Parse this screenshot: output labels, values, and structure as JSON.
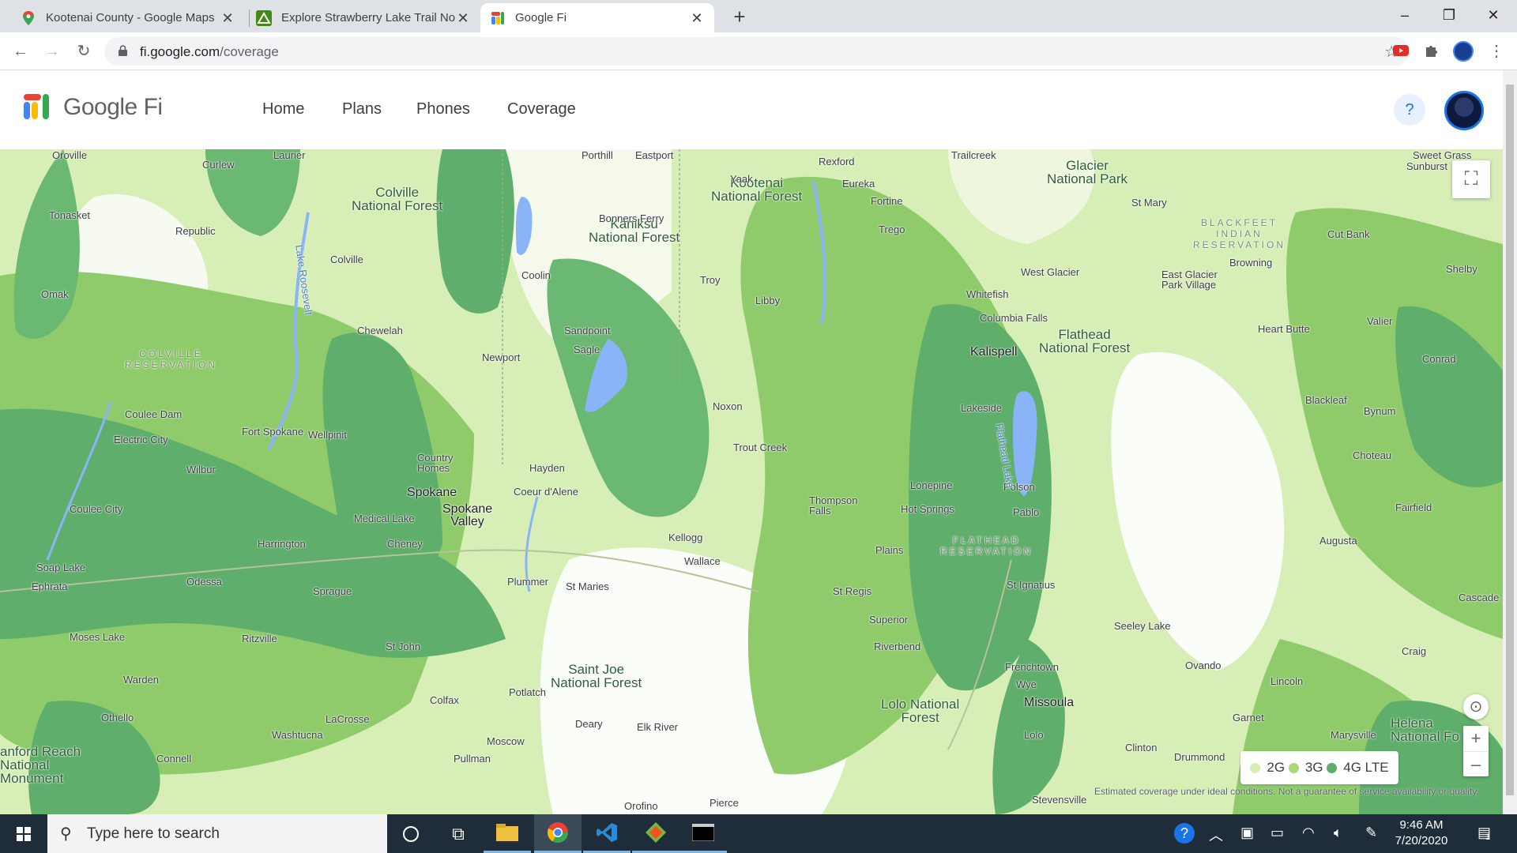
{
  "browser": {
    "tabs": [
      {
        "title": "Kootenai County - Google Maps",
        "icon": "google-maps-icon"
      },
      {
        "title": "Explore Strawberry Lake Trail No",
        "icon": "alltrails-icon"
      },
      {
        "title": "Google Fi",
        "icon": "google-fi-icon",
        "active": true
      }
    ],
    "url_host": "fi.google.com",
    "url_path": "/coverage"
  },
  "fi": {
    "brand": "Google Fi",
    "nav": [
      "Home",
      "Plans",
      "Phones",
      "Coverage"
    ],
    "help": "?"
  },
  "map": {
    "labels": {
      "colville_nf": "Colville\nNational Forest",
      "kootenai_nf": "Kootenai\nNational Forest",
      "kaniksu_nf": "Kaniksu\nNational Forest",
      "glacier_np": "Glacier\nNational Park",
      "flathead_nf": "Flathead\nNational Forest",
      "saint_joe_nf": "Saint Joe\nNational Forest",
      "lolo_nf": "Lolo National\nForest",
      "hanford": "anford Reach\nNational\nMonument",
      "helena_nf": "Helena\nNational Fo",
      "colville_res": "COLVILLE\nRESERVATION",
      "flathead_res": "FLATHEAD\nRESERVATION",
      "blackfeet_res": "BLACKFEET\nINDIAN\nRESERVATION",
      "spokane": "Spokane",
      "spokane_valley": "Spokane\nValley",
      "coeur": "Coeur d'Alene",
      "sandpoint": "Sandpoint",
      "kalispell": "Kalispell",
      "missoula": "Missoula",
      "polson": "Polson",
      "whitefish": "Whitefish",
      "libby": "Libby",
      "yaak": "Yaak",
      "coolin": "Coolin",
      "newport": "Newport",
      "colville": "Colville",
      "republic": "Republic",
      "chewelah": "Chewelah",
      "omak": "Omak",
      "tonasket": "Tonasket",
      "wilbur": "Wilbur",
      "odessa": "Odessa",
      "ritzville": "Ritzville",
      "sprague": "Sprague",
      "cheney": "Cheney",
      "harrington": "Harrington",
      "medical_lake": "Medical Lake",
      "st_maries": "St Maries",
      "plummer": "Plummer",
      "kellogg": "Kellogg",
      "wallace": "Wallace",
      "noxon": "Noxon",
      "trout_creek": "Trout Creek",
      "thompson_falls": "Thompson\nFalls",
      "hot_springs": "Hot Springs",
      "plains": "Plains",
      "st_regis": "St Regis",
      "superior": "Superior",
      "frenchtown": "Frenchtown",
      "lolo": "Lolo",
      "seeley_lake": "Seeley Lake",
      "ovando": "Ovando",
      "lincoln": "Lincoln",
      "augusta": "Augusta",
      "choteau": "Choteau",
      "fairfield": "Fairfield",
      "conrad": "Conrad",
      "valier": "Valier",
      "browning": "Browning",
      "cut_bank": "Cut Bank",
      "shelby": "Shelby",
      "eureka": "Eureka",
      "rexford": "Rexford",
      "fortine": "Fortine",
      "trego": "Trego",
      "pablo": "Pablo",
      "st_ignatius": "St Ignatius",
      "moscow": "Moscow",
      "pullman": "Pullman",
      "colfax": "Colfax",
      "potlatch": "Potlatch",
      "deary": "Deary",
      "elk_river": "Elk River",
      "moses_lake": "Moses Lake",
      "ephrata": "Ephrata",
      "soap_lake": "Soap Lake",
      "warden": "Warden",
      "othello": "Othello",
      "connell": "Connell",
      "lacrosse": "LaCrosse",
      "washtucna": "Washtucna",
      "st_john": "St John",
      "drummond": "Drummond",
      "clinton": "Clinton",
      "garnet": "Garnet",
      "marysville": "Marysville",
      "stevensville": "Stevensville",
      "electric_city": "Electric City",
      "coulee_dam": "Coulee Dam",
      "coulee_city": "Coulee City",
      "fort_spokane": "Fort Spokane",
      "wellpinit": "Wellpinit",
      "hayden": "Hayden",
      "sagle": "Sagle",
      "troy": "Troy",
      "lakeside": "Lakeside",
      "columbia_falls": "Columbia Falls",
      "west_glacier": "West Glacier",
      "st_mary": "St Mary",
      "east_glacier": "East Glacier\nPark Village",
      "heart_butte": "Heart Butte",
      "bynum": "Bynum",
      "kalispell_lake": "Flathead Lake",
      "lake_roosevelt": "Lake Roosevelt",
      "laurier": "Laurier",
      "eastport": "Eastport",
      "porthill": "Porthill",
      "bonners_ferry": "Bonners Ferry",
      "trailcreek": "Trailcreek",
      "sweet_grass": "Sweet Grass",
      "sunburst": "Sunburst",
      "blackleaf": "Blackleaf",
      "craig": "Craig",
      "cascade": "Cascade",
      "pierce": "Pierce",
      "orofino": "Orofino",
      "lonepine": "Lonepine",
      "curlew": "Curlew",
      "oroville": "Oroville",
      "country_homes": "Country\nHomes",
      "riverbend": "Riverbend",
      "wye": "Wye"
    },
    "legend": [
      {
        "label": "2G",
        "color": "#d4efb0"
      },
      {
        "label": "3G",
        "color": "#a9d77a"
      },
      {
        "label": "4G LTE",
        "color": "#5eae6b"
      }
    ],
    "disclaimer": "Estimated coverage under ideal conditions. Not a guarantee of service availability or quality."
  },
  "taskbar": {
    "search_placeholder": "Type here to search",
    "time": "9:46 AM",
    "date": "7/20/2020",
    "notif_count": "1"
  }
}
